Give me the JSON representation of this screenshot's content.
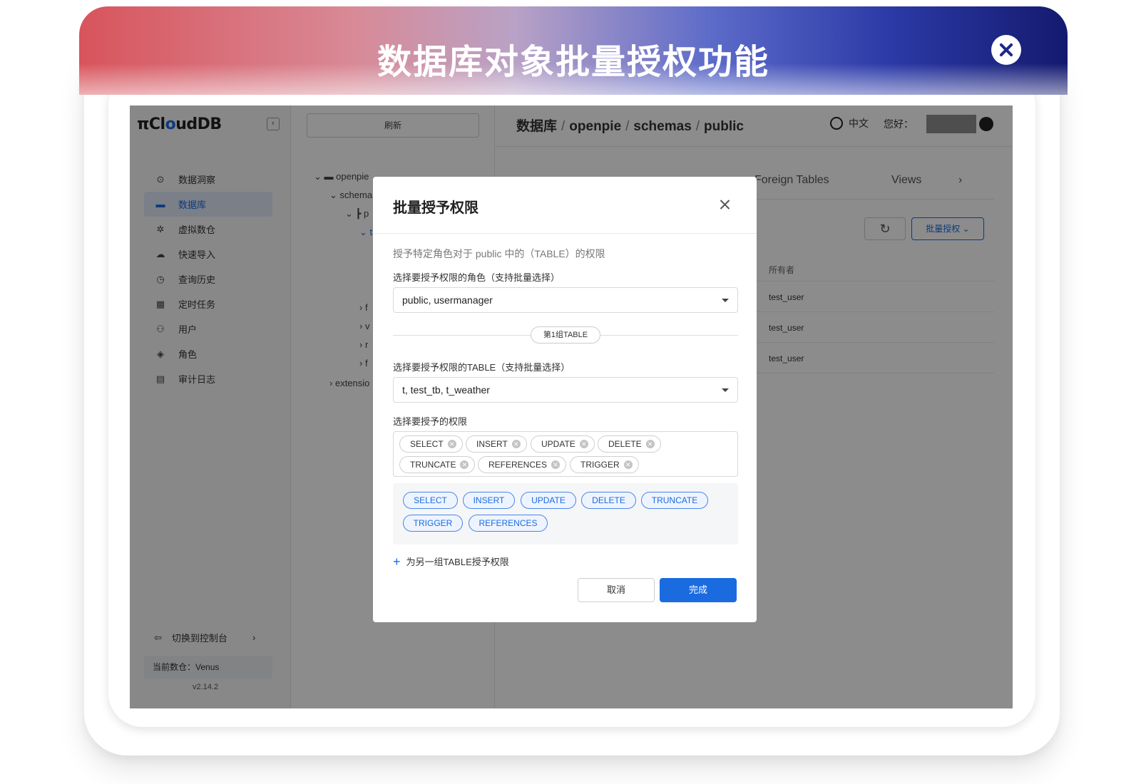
{
  "banner": {
    "title": "数据库对象批量授权功能"
  },
  "sidebar": {
    "logo_prefix": "π",
    "logo_main": "Cl",
    "logo_u": "o",
    "logo_suffix": "udDB",
    "collapse_icon": "‹",
    "items": [
      {
        "label": "数据洞察",
        "icon": "insight-icon",
        "glyph": "⊙"
      },
      {
        "label": "数据库",
        "icon": "database-icon",
        "glyph": "▬"
      },
      {
        "label": "虚拟数仓",
        "icon": "warehouse-icon",
        "glyph": "✲"
      },
      {
        "label": "快速导入",
        "icon": "cloud-upload-icon",
        "glyph": "☁"
      },
      {
        "label": "查询历史",
        "icon": "history-icon",
        "glyph": "◷"
      },
      {
        "label": "定时任务",
        "icon": "calendar-icon",
        "glyph": "▦"
      },
      {
        "label": "用户",
        "icon": "users-icon",
        "glyph": "⚇"
      },
      {
        "label": "角色",
        "icon": "shield-icon",
        "glyph": "◈"
      },
      {
        "label": "审计日志",
        "icon": "audit-log-icon",
        "glyph": "▤"
      }
    ],
    "switch_console": "切换到控制台",
    "current_warehouse": "当前数仓：Venus",
    "version": "v2.14.2"
  },
  "tree": {
    "refresh_label": "刷新",
    "nodes": [
      {
        "label": "openpie",
        "glyph": "⌄ ▬"
      },
      {
        "label": "schema",
        "glyph": "⌄"
      },
      {
        "label": "p",
        "glyph": "⌄ ┣"
      },
      {
        "label": "t",
        "glyph": "⌄"
      },
      {
        "label": "f",
        "glyph": "›"
      },
      {
        "label": "v",
        "glyph": "›"
      },
      {
        "label": "r",
        "glyph": "›"
      },
      {
        "label": "f",
        "glyph": "›"
      },
      {
        "label": "extensio",
        "glyph": "›"
      }
    ]
  },
  "main": {
    "breadcrumb": [
      "数据库",
      "openpie",
      "schemas",
      "public"
    ],
    "lang": "中文",
    "greeting": "您好：",
    "tabs": [
      "Foreign Tables",
      "Views",
      "›"
    ],
    "bulk_button": "批量授权",
    "owner_header": "所有者",
    "owners": [
      "test_user",
      "test_user",
      "test_user"
    ]
  },
  "modal": {
    "title": "批量授予权限",
    "description": "授予特定角色对于 public 中的（TABLE）的权限",
    "role_label": "选择要授予权限的角色（支持批量选择）",
    "role_value": "public, usermanager",
    "group_tag": "第1组TABLE",
    "table_label": "选择要授予权限的TABLE（支持批量选择）",
    "table_value": "t, test_tb, t_weather",
    "perm_label": "选择要授予的权限",
    "selected_permissions": [
      "SELECT",
      "INSERT",
      "UPDATE",
      "DELETE",
      "TRUNCATE",
      "REFERENCES",
      "TRIGGER"
    ],
    "option_permissions": [
      "SELECT",
      "INSERT",
      "UPDATE",
      "DELETE",
      "TRUNCATE",
      "TRIGGER",
      "REFERENCES"
    ],
    "add_group": "为另一组TABLE授予权限",
    "cancel": "取消",
    "done": "完成",
    "accent_color": "#1a6be0"
  }
}
